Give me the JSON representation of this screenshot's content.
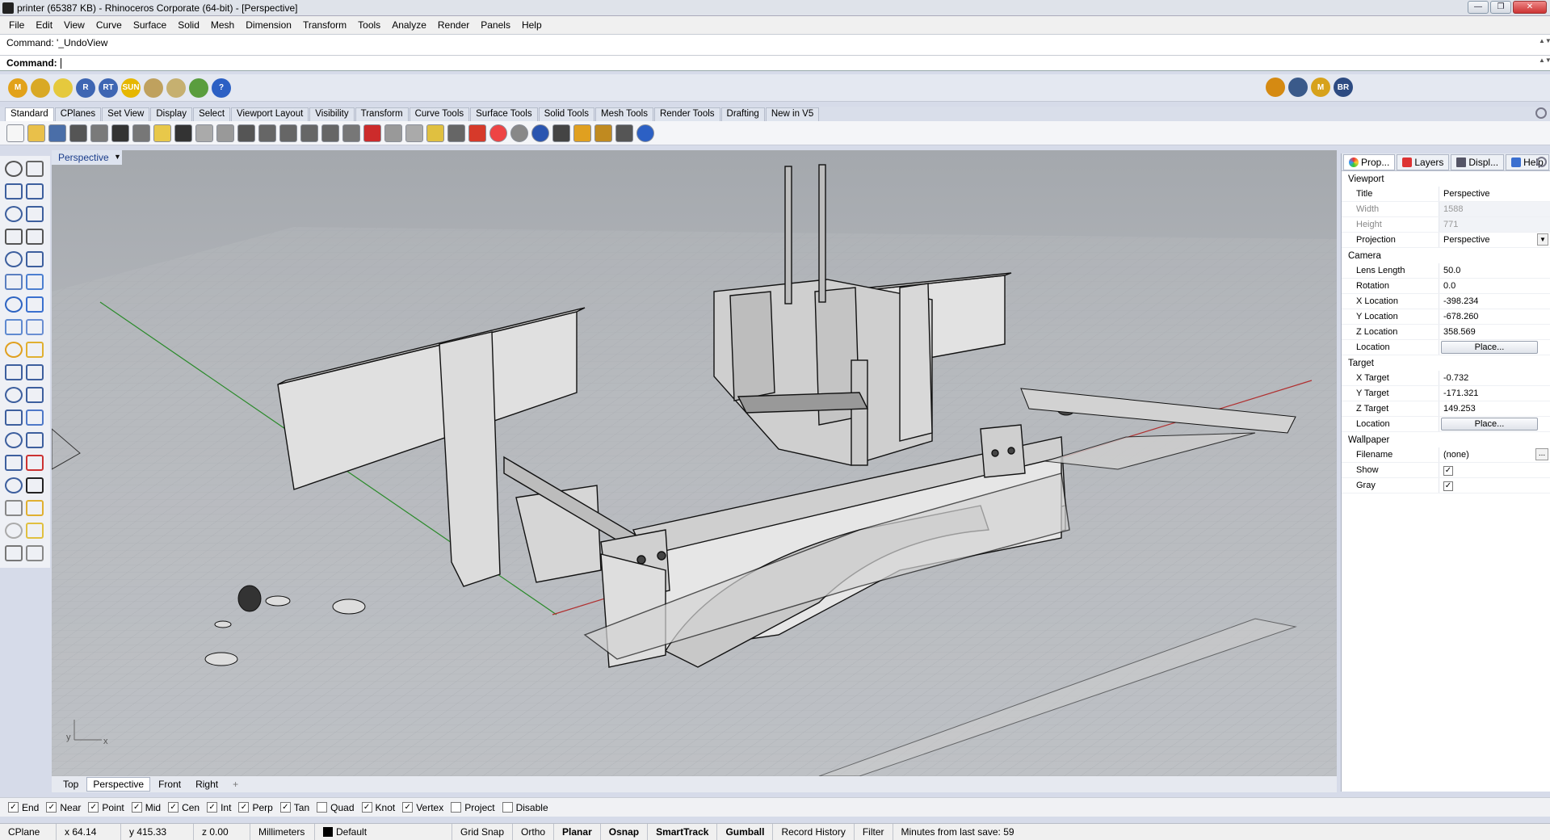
{
  "window": {
    "title": "printer (65387 KB) - Rhinoceros Corporate (64-bit) - [Perspective]",
    "controls": [
      "—",
      "❐",
      "✕"
    ]
  },
  "menu": [
    "File",
    "Edit",
    "View",
    "Curve",
    "Surface",
    "Solid",
    "Mesh",
    "Dimension",
    "Transform",
    "Tools",
    "Analyze",
    "Render",
    "Panels",
    "Help"
  ],
  "command": {
    "history": "Command: '_UndoView",
    "prompt": "Command:"
  },
  "plugin_buttons": [
    {
      "label": "M",
      "icon": "m-plugin-icon",
      "color": "#e2a21a"
    },
    {
      "label": "",
      "icon": "plugin-gem-icon",
      "color": "#d9a925"
    },
    {
      "label": "",
      "icon": "plugin-tag-icon",
      "color": "#e5c93d"
    },
    {
      "label": "R",
      "icon": "rhino-render-icon",
      "color": "#3e66b3"
    },
    {
      "label": "RT",
      "icon": "render-tools-icon",
      "color": "#3e66b3"
    },
    {
      "label": "SUN",
      "icon": "sun-icon",
      "color": "#e6b700"
    },
    {
      "label": "",
      "icon": "plugin-wand-icon",
      "color": "#bfa15e"
    },
    {
      "label": "",
      "icon": "plugin-layer-icon",
      "color": "#c6b070"
    },
    {
      "label": "",
      "icon": "plugin-tree-icon",
      "color": "#5a9d3e"
    },
    {
      "label": "?",
      "icon": "help-icon",
      "color": "#2c60c4"
    }
  ],
  "plugin_right": [
    {
      "label": "",
      "icon": "target-icon",
      "color": "#d58a12"
    },
    {
      "label": "",
      "icon": "rhino-logo-icon",
      "color": "#3a5a8a"
    },
    {
      "label": "M",
      "icon": "m-plugin-icon",
      "color": "#d7a21b"
    },
    {
      "label": "BR",
      "icon": "bongo-icon",
      "color": "#2d4b82"
    }
  ],
  "toolbar_tabs": [
    "Standard",
    "CPlanes",
    "Set View",
    "Display",
    "Select",
    "Viewport Layout",
    "Visibility",
    "Transform",
    "Curve Tools",
    "Surface Tools",
    "Solid Tools",
    "Mesh Tools",
    "Render Tools",
    "Drafting",
    "New in V5"
  ],
  "toolbar_active": "Standard",
  "standard_tools": [
    "new-icon",
    "open-icon",
    "save-icon",
    "print-icon",
    "import-icon",
    "cut-icon",
    "copy-icon",
    "paste-icon",
    "undo-icon",
    "pan-icon",
    "rotate-view-icon",
    "zoom-icon",
    "zoom-window-icon",
    "zoom-extents-icon",
    "zoom-selected-icon",
    "undo-view-icon",
    "four-viewports-icon",
    "car-icon",
    "layer-icon",
    "properties-icon",
    "lightbulb-icon",
    "lock-icon",
    "material-icon",
    "color-wheel-icon",
    "shade-icon",
    "render-sphere-icon",
    "render-icon",
    "options-icon",
    "gear-icon",
    "dimension-icon",
    "help-icon"
  ],
  "viewport": {
    "name": "Perspective",
    "tabs": [
      "Top",
      "Perspective",
      "Front",
      "Right"
    ],
    "active_tab": "Perspective",
    "add_tab": "+"
  },
  "osnaps": [
    {
      "label": "End",
      "checked": true
    },
    {
      "label": "Near",
      "checked": true
    },
    {
      "label": "Point",
      "checked": true
    },
    {
      "label": "Mid",
      "checked": true
    },
    {
      "label": "Cen",
      "checked": true
    },
    {
      "label": "Int",
      "checked": true
    },
    {
      "label": "Perp",
      "checked": true
    },
    {
      "label": "Tan",
      "checked": true
    },
    {
      "label": "Quad",
      "checked": false
    },
    {
      "label": "Knot",
      "checked": true
    },
    {
      "label": "Vertex",
      "checked": true
    },
    {
      "label": "Project",
      "checked": false
    },
    {
      "label": "Disable",
      "checked": false
    }
  ],
  "status": {
    "cplane": "CPlane",
    "x": "x 64.14",
    "y": "y 415.33",
    "z": "z 0.00",
    "units": "Millimeters",
    "layer": "Default",
    "grid_snap": "Grid Snap",
    "ortho": "Ortho",
    "planar": "Planar",
    "osnap": "Osnap",
    "smarttrack": "SmartTrack",
    "gumball": "Gumball",
    "record_history": "Record History",
    "filter": "Filter",
    "save_info": "Minutes from last save: 59"
  },
  "panel": {
    "tabs": [
      "Prop...",
      "Layers",
      "Displ...",
      "Help"
    ],
    "tab_icons": [
      "properties-icon",
      "layers-icon",
      "display-icon",
      "help-icon"
    ],
    "sections": {
      "viewport": "Viewport",
      "camera": "Camera",
      "target": "Target",
      "wallpaper": "Wallpaper"
    },
    "viewport": {
      "title_label": "Title",
      "title_value": "Perspective",
      "width_label": "Width",
      "width_value": "1588",
      "height_label": "Height",
      "height_value": "771",
      "projection_label": "Projection",
      "projection_value": "Perspective"
    },
    "camera": {
      "lens_label": "Lens Length",
      "lens_value": "50.0",
      "rotation_label": "Rotation",
      "rotation_value": "0.0",
      "x_label": "X Location",
      "x_value": "-398.234",
      "y_label": "Y Location",
      "y_value": "-678.260",
      "z_label": "Z Location",
      "z_value": "358.569",
      "location_label": "Location",
      "location_button": "Place..."
    },
    "target": {
      "x_label": "X Target",
      "x_value": "-0.732",
      "y_label": "Y Target",
      "y_value": "-171.321",
      "z_label": "Z Target",
      "z_value": "149.253",
      "location_label": "Location",
      "location_button": "Place..."
    },
    "wallpaper": {
      "filename_label": "Filename",
      "filename_value": "(none)",
      "filename_button": "...",
      "show_label": "Show",
      "show_checked": true,
      "gray_label": "Gray",
      "gray_checked": true
    }
  },
  "axis_labels": {
    "y": "y",
    "x": "x"
  }
}
